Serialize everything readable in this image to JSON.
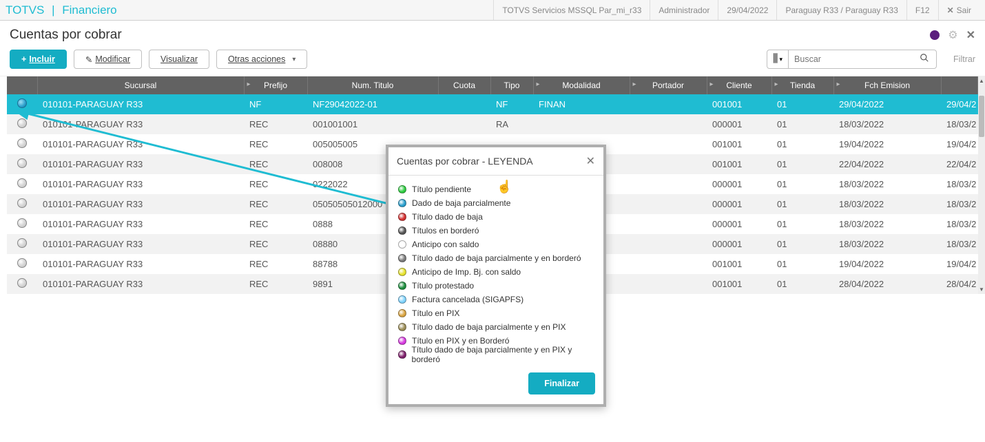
{
  "header": {
    "brand": "TOTVS",
    "module": "Financiero",
    "conn": "TOTVS Servicios MSSQL Par_mi_r33",
    "user": "Administrador",
    "date": "29/04/2022",
    "env": "Paraguay R33 / Paraguay R33",
    "f12": "F12",
    "exit": "Sair"
  },
  "page": {
    "title": "Cuentas por cobrar"
  },
  "toolbar": {
    "include": "Incluir",
    "modify": "Modificar",
    "view": "Visualizar",
    "other": "Otras acciones",
    "search_placeholder": "Buscar",
    "filter": "Filtrar"
  },
  "grid": {
    "headers": {
      "sucursal": "Sucursal",
      "prefijo": "Prefijo",
      "numtitulo": "Num. Titulo",
      "cuota": "Cuota",
      "tipo": "Tipo",
      "modalidad": "Modalidad",
      "portador": "Portador",
      "cliente": "Cliente",
      "tienda": "Tienda",
      "fchemision": "Fch Emision"
    },
    "rows": [
      {
        "selected": true,
        "status": "blue",
        "sucursal": "010101-PARAGUAY R33",
        "prefijo": "NF",
        "numtitulo": "NF29042022-01",
        "cuota": "",
        "tipo": "NF",
        "modalidad": "FINAN",
        "portador": "",
        "cliente": "001001",
        "tienda": "01",
        "fch": "29/04/2022",
        "extra": "29/04/2"
      },
      {
        "selected": false,
        "status": "white",
        "sucursal": "010101-PARAGUAY R33",
        "prefijo": "REC",
        "numtitulo": "001001001",
        "cuota": "",
        "tipo": "RA",
        "modalidad": "",
        "portador": "",
        "cliente": "000001",
        "tienda": "01",
        "fch": "18/03/2022",
        "extra": "18/03/2"
      },
      {
        "selected": false,
        "status": "white",
        "sucursal": "010101-PARAGUAY R33",
        "prefijo": "REC",
        "numtitulo": "005005005",
        "cuota": "",
        "tipo": "",
        "modalidad": "",
        "portador": "",
        "cliente": "001001",
        "tienda": "01",
        "fch": "19/04/2022",
        "extra": "19/04/2"
      },
      {
        "selected": false,
        "status": "white",
        "sucursal": "010101-PARAGUAY R33",
        "prefijo": "REC",
        "numtitulo": "008008",
        "cuota": "",
        "tipo": "",
        "modalidad": "",
        "portador": "",
        "cliente": "001001",
        "tienda": "01",
        "fch": "22/04/2022",
        "extra": "22/04/2"
      },
      {
        "selected": false,
        "status": "white",
        "sucursal": "010101-PARAGUAY R33",
        "prefijo": "REC",
        "numtitulo": "0222022",
        "cuota": "",
        "tipo": "",
        "modalidad": "",
        "portador": "",
        "cliente": "000001",
        "tienda": "01",
        "fch": "18/03/2022",
        "extra": "18/03/2"
      },
      {
        "selected": false,
        "status": "white",
        "sucursal": "010101-PARAGUAY R33",
        "prefijo": "REC",
        "numtitulo": "05050505012000",
        "cuota": "",
        "tipo": "",
        "modalidad": "",
        "portador": "",
        "cliente": "000001",
        "tienda": "01",
        "fch": "18/03/2022",
        "extra": "18/03/2"
      },
      {
        "selected": false,
        "status": "white",
        "sucursal": "010101-PARAGUAY R33",
        "prefijo": "REC",
        "numtitulo": "0888",
        "cuota": "",
        "tipo": "",
        "modalidad": "",
        "portador": "",
        "cliente": "000001",
        "tienda": "01",
        "fch": "18/03/2022",
        "extra": "18/03/2"
      },
      {
        "selected": false,
        "status": "white",
        "sucursal": "010101-PARAGUAY R33",
        "prefijo": "REC",
        "numtitulo": "08880",
        "cuota": "",
        "tipo": "",
        "modalidad": "",
        "portador": "",
        "cliente": "000001",
        "tienda": "01",
        "fch": "18/03/2022",
        "extra": "18/03/2"
      },
      {
        "selected": false,
        "status": "white",
        "sucursal": "010101-PARAGUAY R33",
        "prefijo": "REC",
        "numtitulo": "88788",
        "cuota": "",
        "tipo": "",
        "modalidad": "",
        "portador": "",
        "cliente": "001001",
        "tienda": "01",
        "fch": "19/04/2022",
        "extra": "19/04/2"
      },
      {
        "selected": false,
        "status": "white",
        "sucursal": "010101-PARAGUAY R33",
        "prefijo": "REC",
        "numtitulo": "9891",
        "cuota": "",
        "tipo": "",
        "modalidad": "",
        "portador": "",
        "cliente": "001001",
        "tienda": "01",
        "fch": "28/04/2022",
        "extra": "28/04/2"
      }
    ]
  },
  "legend": {
    "title": "Cuentas por cobrar - LEYENDA",
    "items": [
      {
        "color": "#2ecc40",
        "label": "Título pendiente"
      },
      {
        "color": "#2a9ecc",
        "label": "Dado de baja parcialmente"
      },
      {
        "color": "#d32f2f",
        "label": "Título dado de baja"
      },
      {
        "color": "#555555",
        "label": "Títulos en borderó"
      },
      {
        "color": "#ffffff",
        "label": "Anticipo con saldo"
      },
      {
        "color": "#7a7a7a",
        "label": "Título dado de baja parcialmente y en borderó"
      },
      {
        "color": "#e6e22e",
        "label": "Anticipo de Imp. Bj. con saldo"
      },
      {
        "color": "#1e8e3e",
        "label": "Título protestado"
      },
      {
        "color": "#7fd3ff",
        "label": "Factura cancelada (SIGAPFS)"
      },
      {
        "color": "#d9a441",
        "label": "Título en PIX"
      },
      {
        "color": "#9b8d57",
        "label": "Título dado de baja parcialmente y en PIX"
      },
      {
        "color": "#d63adf",
        "label": "Título en PIX y en Borderó"
      },
      {
        "color": "#7e1f6b",
        "label": "Título dado de baja parcialmente y en PIX y borderó"
      }
    ],
    "finish": "Finalizar"
  }
}
